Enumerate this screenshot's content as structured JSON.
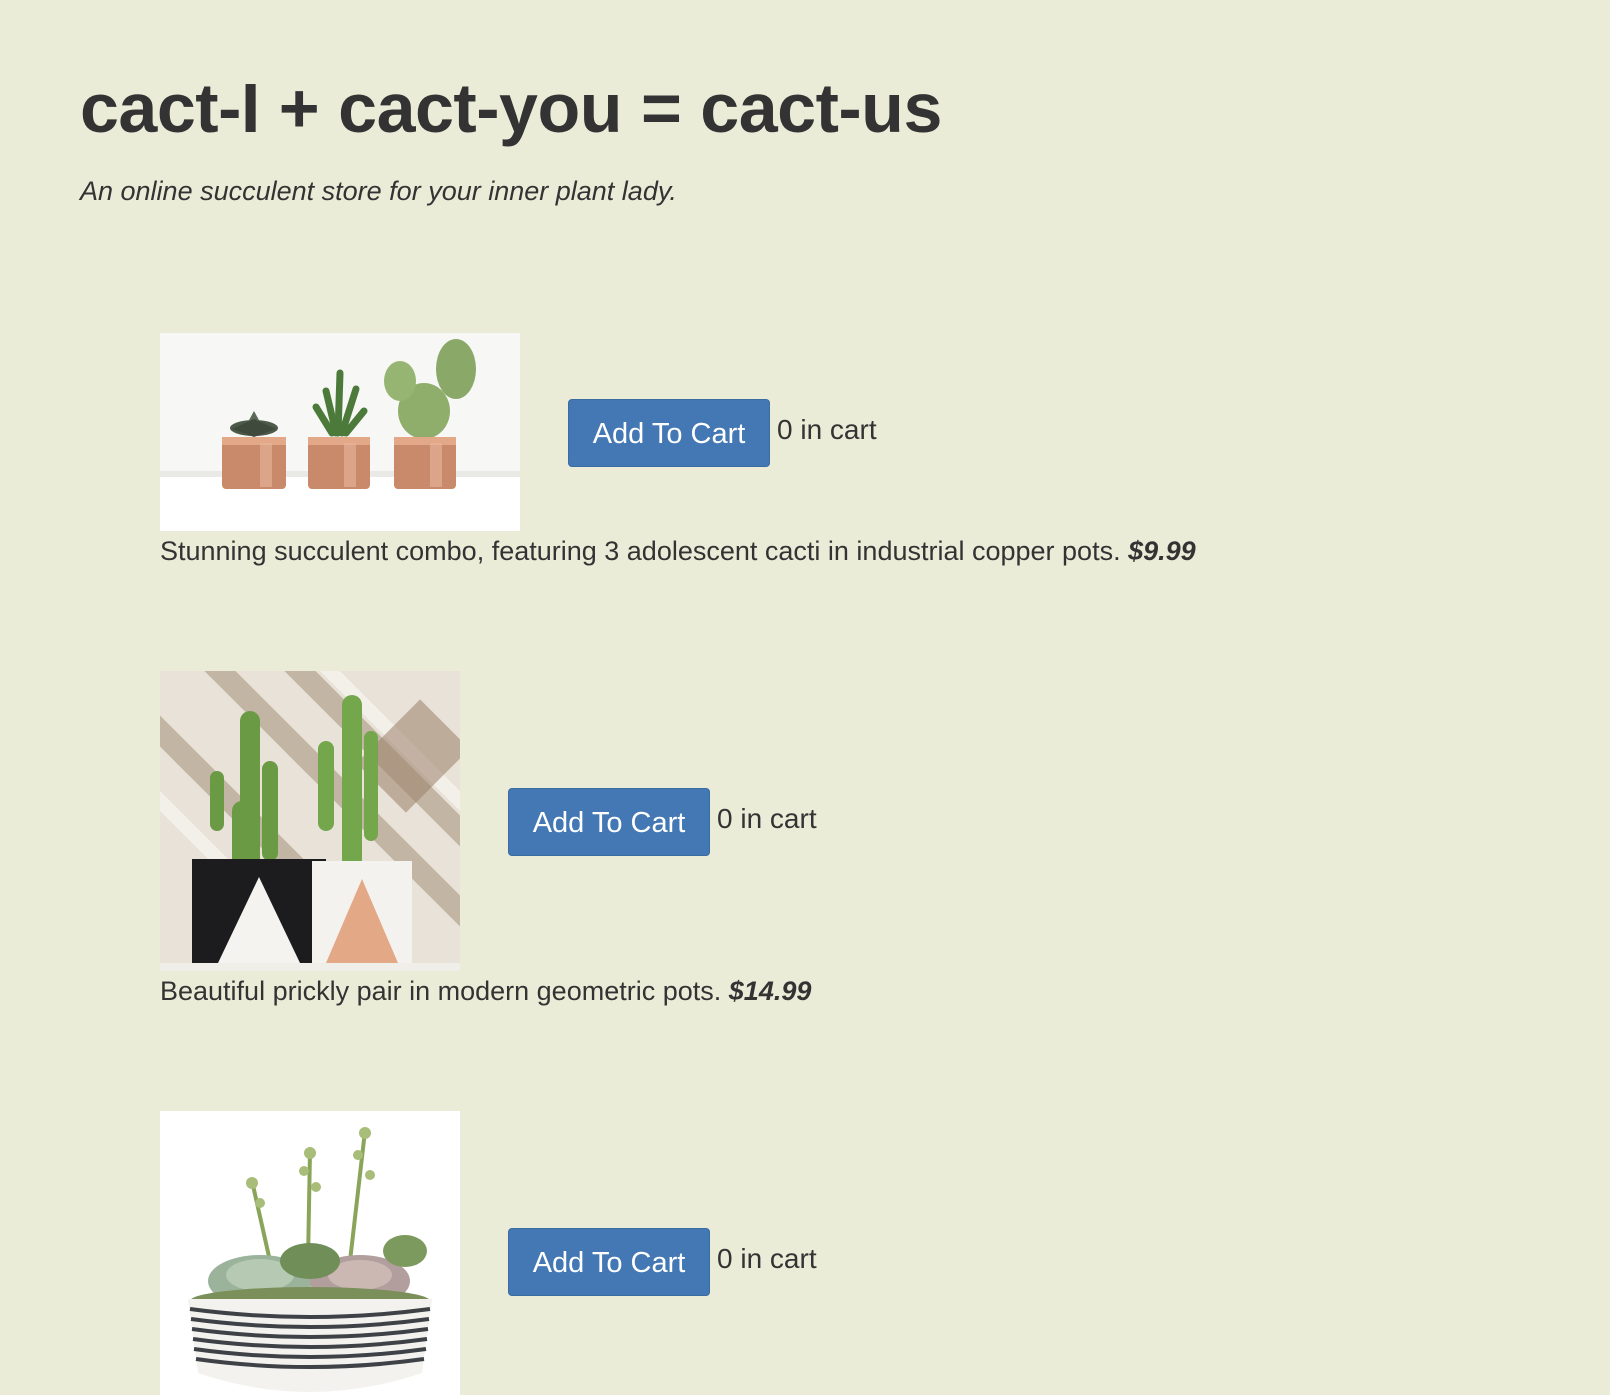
{
  "header": {
    "title": "cact-I + cact-you = cact-us",
    "subtitle": "An online succulent store for your inner plant lady."
  },
  "products": [
    {
      "description": "Stunning succulent combo, featuring 3 adolescent cacti in industrial copper pots.",
      "price": "$9.99",
      "button_label": "Add To Cart",
      "cart_text": "0 in cart"
    },
    {
      "description": "Beautiful prickly pair in modern geometric pots.",
      "price": "$14.99",
      "button_label": "Add To Cart",
      "cart_text": "0 in cart"
    },
    {
      "button_label": "Add To Cart",
      "cart_text": "0 in cart"
    }
  ],
  "colors": {
    "background": "#ebecd8",
    "button": "#4378b4",
    "text": "#333333"
  }
}
